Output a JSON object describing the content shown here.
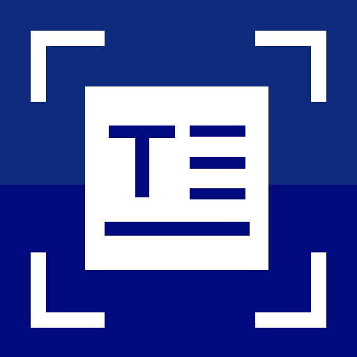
{
  "icon": {
    "name": "text-scanner-app-icon",
    "glyph": "T",
    "colors": {
      "background_top": "#0e2a7d",
      "background_bottom": "#000a7c",
      "foreground": "#ffffff",
      "glyph": "#000a7c"
    }
  }
}
